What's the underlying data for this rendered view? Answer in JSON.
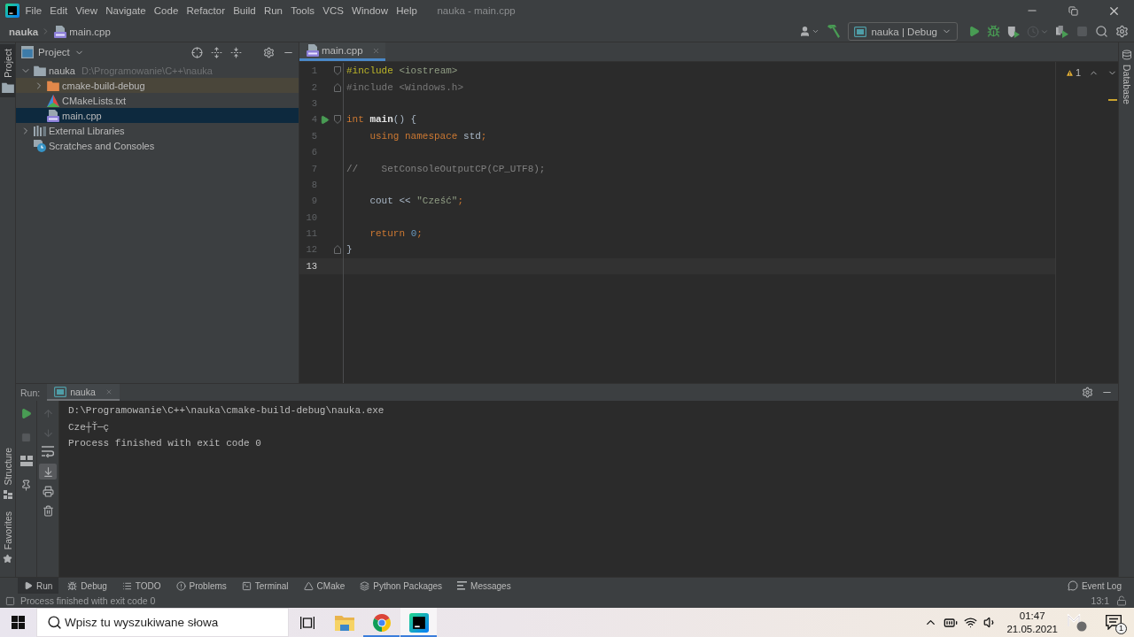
{
  "menu_bar": {
    "items": [
      "File",
      "Edit",
      "View",
      "Navigate",
      "Code",
      "Refactor",
      "Build",
      "Run",
      "Tools",
      "VCS",
      "Window",
      "Help"
    ],
    "title": "nauka - main.cpp"
  },
  "navigation_bar": {
    "breadcrumbs": [
      {
        "label": "nauka",
        "kind": "project"
      },
      {
        "label": "main.cpp",
        "kind": "cpp"
      }
    ],
    "toolbar": [
      {
        "kind": "account",
        "disabled": false
      },
      {
        "kind": "build",
        "disabled": false
      },
      {
        "kind": "configuration",
        "label": "nauka | Debug",
        "disabled": false
      },
      {
        "kind": "run",
        "disabled": false
      },
      {
        "kind": "debug",
        "disabled": false
      },
      {
        "kind": "coverage",
        "disabled": false
      },
      {
        "kind": "profile",
        "disabled": true
      },
      {
        "kind": "attach",
        "disabled": false
      },
      {
        "kind": "stop",
        "disabled": true
      },
      {
        "kind": "search",
        "disabled": false
      },
      {
        "kind": "settings",
        "disabled": false
      }
    ]
  },
  "tool_window_stripes": {
    "left_top": [
      {
        "label": "Project",
        "kind": "project",
        "selected": true
      }
    ],
    "left_bottom": [
      {
        "label": "Structure",
        "kind": "structure",
        "selected": false
      },
      {
        "label": "Favorites",
        "kind": "favorites",
        "selected": false
      }
    ],
    "right": [
      {
        "label": "Database",
        "kind": "database",
        "selected": false
      }
    ]
  },
  "project_panel": {
    "title": "Project",
    "tree": [
      {
        "label": "nauka",
        "kind": "module",
        "path": "D:\\Programowanie\\C++\\nauka",
        "expanded": true,
        "selected": false,
        "highlighted": false,
        "children": [
          {
            "label": "cmake-build-debug",
            "kind": "folder",
            "expanded": false,
            "selected": false,
            "highlighted": true
          },
          {
            "label": "CMakeLists.txt",
            "kind": "cmake",
            "selected": false,
            "highlighted": false
          },
          {
            "label": "main.cpp",
            "kind": "cpp",
            "selected": true,
            "highlighted": false
          }
        ]
      },
      {
        "label": "External Libraries",
        "kind": "libraries",
        "expanded": false,
        "selected": false,
        "highlighted": false
      },
      {
        "label": "Scratches and Consoles",
        "kind": "scratches",
        "selected": false,
        "highlighted": false
      }
    ]
  },
  "editor": {
    "tabs": [
      {
        "label": "main.cpp",
        "kind": "cpp",
        "selected": true
      }
    ],
    "warning_count": "1",
    "lines": [
      {
        "number": "1",
        "fold_start": true,
        "fold_end": false,
        "run_marker": false,
        "current": false,
        "tokens": [
          {
            "text": "#include ",
            "kind": "directive"
          },
          {
            "text": "<iostream>",
            "kind": "header"
          }
        ]
      },
      {
        "number": "2",
        "fold_start": false,
        "fold_end": true,
        "run_marker": false,
        "current": false,
        "tokens": [
          {
            "text": "#include <Windows.h>",
            "kind": "unused"
          }
        ]
      },
      {
        "number": "3",
        "fold_start": false,
        "fold_end": false,
        "run_marker": false,
        "current": false
      },
      {
        "number": "4",
        "fold_start": true,
        "fold_end": false,
        "run_marker": true,
        "current": false,
        "tokens": [
          {
            "text": "int ",
            "kind": "keyword"
          },
          {
            "text": "main",
            "kind": "function"
          },
          {
            "text": "() {",
            "kind": "plain"
          }
        ]
      },
      {
        "number": "5",
        "fold_start": false,
        "fold_end": false,
        "run_marker": false,
        "current": false,
        "tokens": [
          {
            "text": "    using namespace ",
            "kind": "keyword"
          },
          {
            "text": "std",
            "kind": "plain"
          },
          {
            "text": ";",
            "kind": "punctuation"
          }
        ]
      },
      {
        "number": "6",
        "fold_start": false,
        "fold_end": false,
        "run_marker": false,
        "current": false
      },
      {
        "number": "7",
        "fold_start": false,
        "fold_end": false,
        "run_marker": false,
        "current": false,
        "tokens": [
          {
            "text": "//    SetConsoleOutputCP(CP_UTF8);",
            "kind": "comment"
          }
        ]
      },
      {
        "number": "8",
        "fold_start": false,
        "fold_end": false,
        "run_marker": false,
        "current": false
      },
      {
        "number": "9",
        "fold_start": false,
        "fold_end": false,
        "run_marker": false,
        "current": false,
        "tokens": [
          {
            "text": "    cout ",
            "kind": "plain"
          },
          {
            "text": "<< ",
            "kind": "operator"
          },
          {
            "text": "\"Cześć\"",
            "kind": "string"
          },
          {
            "text": ";",
            "kind": "punctuation"
          }
        ]
      },
      {
        "number": "10",
        "fold_start": false,
        "fold_end": false,
        "run_marker": false,
        "current": false
      },
      {
        "number": "11",
        "fold_start": false,
        "fold_end": false,
        "run_marker": false,
        "current": false,
        "tokens": [
          {
            "text": "    return ",
            "kind": "keyword"
          },
          {
            "text": "0",
            "kind": "number"
          },
          {
            "text": ";",
            "kind": "punctuation"
          }
        ]
      },
      {
        "number": "12",
        "fold_start": false,
        "fold_end": true,
        "run_marker": false,
        "current": false,
        "tokens": [
          {
            "text": "}",
            "kind": "plain"
          }
        ]
      },
      {
        "number": "13",
        "fold_start": false,
        "fold_end": false,
        "run_marker": false,
        "current": true
      }
    ]
  },
  "run_panel": {
    "title": "Run:",
    "tabs": [
      {
        "label": "nauka",
        "selected": true
      }
    ],
    "actions": [
      {
        "kind": "rerun",
        "disabled": false
      },
      {
        "kind": "stop",
        "disabled": true
      },
      {
        "kind": "layout",
        "disabled": false
      },
      {
        "kind": "pin",
        "disabled": false
      }
    ],
    "console_tools": [
      {
        "kind": "up",
        "disabled": true,
        "on": false
      },
      {
        "kind": "down",
        "disabled": true,
        "on": false
      },
      {
        "kind": "soft-wrap",
        "disabled": false,
        "on": false
      },
      {
        "kind": "scroll-to-end",
        "disabled": false,
        "on": true
      },
      {
        "kind": "print",
        "disabled": false,
        "on": false
      },
      {
        "kind": "clear",
        "disabled": false,
        "on": false
      }
    ],
    "output": [
      "D:\\Programowanie\\C++\\nauka\\cmake-build-debug\\nauka.exe",
      "Cze┼Ť─ç",
      "Process finished with exit code 0"
    ]
  },
  "tool_window_bar": {
    "items": [
      {
        "label": "Run",
        "kind": "run",
        "selected": true
      },
      {
        "label": "Debug",
        "kind": "debug",
        "selected": false
      },
      {
        "label": "TODO",
        "kind": "todo",
        "selected": false
      },
      {
        "label": "Problems",
        "kind": "problems",
        "selected": false
      },
      {
        "label": "Terminal",
        "kind": "terminal",
        "selected": false
      },
      {
        "label": "CMake",
        "kind": "cmake",
        "selected": false
      },
      {
        "label": "Python Packages",
        "kind": "packages",
        "selected": false
      },
      {
        "label": "Messages",
        "kind": "messages",
        "selected": false
      }
    ],
    "right": [
      {
        "label": "Event Log",
        "kind": "event-log",
        "selected": false
      }
    ]
  },
  "status_bar": {
    "message": "Process finished with exit code 0",
    "position": "13:1"
  },
  "taskbar": {
    "search": {
      "placeholder": "Wpisz tu wyszukiwane słowa"
    },
    "apps": [
      {
        "kind": "files",
        "running": false,
        "selected": false
      },
      {
        "kind": "browser",
        "running": true,
        "selected": false
      },
      {
        "kind": "ide",
        "running": true,
        "selected": true
      }
    ],
    "clock": {
      "time": "01:47",
      "date": "21.05.2021"
    },
    "notification_count": "1"
  }
}
